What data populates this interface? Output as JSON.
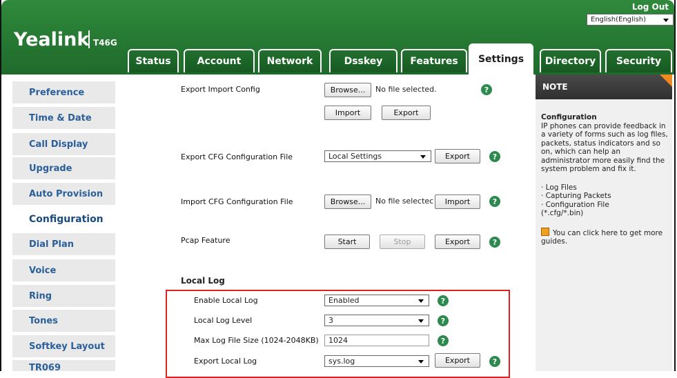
{
  "header": {
    "logo": "Yealink",
    "model": "T46G",
    "logout_label": "Log Out",
    "language": "English(English)",
    "tabs": [
      "Status",
      "Account",
      "Network",
      "Dsskey",
      "Features",
      "Settings",
      "Directory",
      "Security"
    ],
    "active_tab": "Settings"
  },
  "sidebar": {
    "items": [
      "Preference",
      "Time & Date",
      "Call Display",
      "Upgrade",
      "Auto Provision",
      "Configuration",
      "Dial Plan",
      "Voice",
      "Ring",
      "Tones",
      "Softkey Layout",
      "TR069"
    ],
    "active": "Configuration"
  },
  "main": {
    "export_import": {
      "label": "Export Import Config",
      "browse": "Browse...",
      "file_status": "No file selected.",
      "import": "Import",
      "export": "Export"
    },
    "export_cfg": {
      "label": "Export CFG Configuration File",
      "select_value": "Local Settings",
      "export": "Export"
    },
    "import_cfg": {
      "label": "Import CFG Configuration File",
      "browse": "Browse...",
      "file_status": "No file selectec",
      "import": "Import"
    },
    "pcap": {
      "label": "Pcap Feature",
      "start": "Start",
      "stop": "Stop",
      "export": "Export"
    },
    "local_log": {
      "title": "Local Log",
      "enable_label": "Enable Local Log",
      "enable_value": "Enabled",
      "level_label": "Local Log Level",
      "level_value": "3",
      "max_size_label": "Max Log File Size (1024-2048KB)",
      "max_size_value": "1024",
      "export_label": "Export Local Log",
      "export_value": "sys.log",
      "export_button": "Export"
    },
    "help_glyph": "?"
  },
  "note": {
    "title": "NOTE",
    "heading": "Configuration",
    "text": "IP phones can provide feedback in a variety of forms such as log files, packets, status indicators and so on, which can help an administrator more easily find the system problem and fix it.",
    "bullets": [
      "· Log Files",
      "· Capturing Packets",
      "· Configuration File",
      "(*.cfg/*.bin)"
    ],
    "guide": "You can click here to get more guides."
  },
  "colors": {
    "header_green": "#2f8a3c",
    "tab_green": "#1a6326",
    "nav_text": "#2a5f9a",
    "highlight_red": "#e02020",
    "note_accent": "#f08a20"
  }
}
